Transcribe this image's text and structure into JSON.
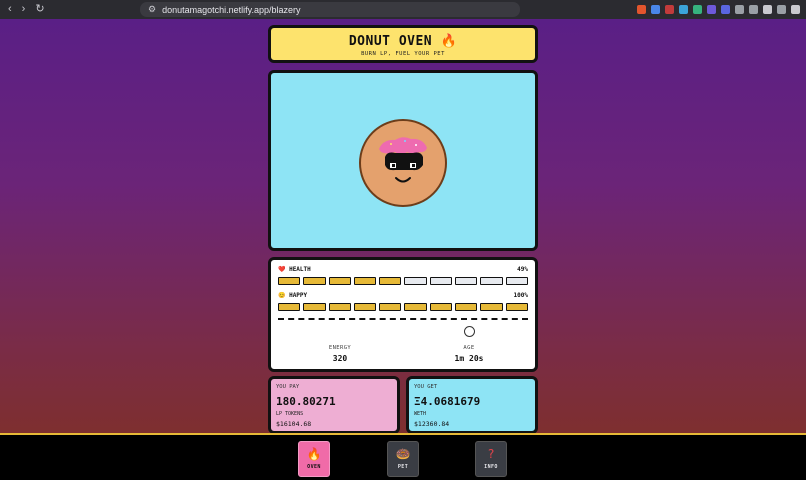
{
  "browser": {
    "url": "donutamagotchi.netlify.app/blazery",
    "back_icon": "‹",
    "forward_icon": "›",
    "reload_icon": "↻"
  },
  "header": {
    "title": "DONUT OVEN 🔥",
    "subtitle": "BURN LP, FUEL YOUR PET"
  },
  "stats": {
    "health": {
      "label": "❤️ HEALTH",
      "value": "49%",
      "fraction": 0.49
    },
    "happy": {
      "label": "😊 HAPPY",
      "value": "100%",
      "fraction": 1.0
    },
    "energy": {
      "label": "ENERGY",
      "value": "320"
    },
    "age": {
      "label": "AGE",
      "value": "1m 20s"
    }
  },
  "exchange": {
    "pay": {
      "label": "YOU PAY",
      "amount": "180.80271",
      "unit": "LP TOKENS",
      "usd": "$16104.68"
    },
    "get": {
      "label": "YOU GET",
      "amount": "Ξ4.0681679",
      "unit": "WETH",
      "usd": "$12360.84"
    }
  },
  "tabs": {
    "oven": {
      "label": "OVEN",
      "icon": "🔥"
    },
    "pet": {
      "label": "PET",
      "icon": "🍩"
    },
    "info": {
      "label": "INFO",
      "icon": "?"
    }
  },
  "colors": {
    "title_bg": "#fde36d",
    "pet_bg": "#8ee4f5",
    "pay_bg": "#eeaed3",
    "bar_on": "#e6b937",
    "oven_tab": "#f06ba8"
  }
}
